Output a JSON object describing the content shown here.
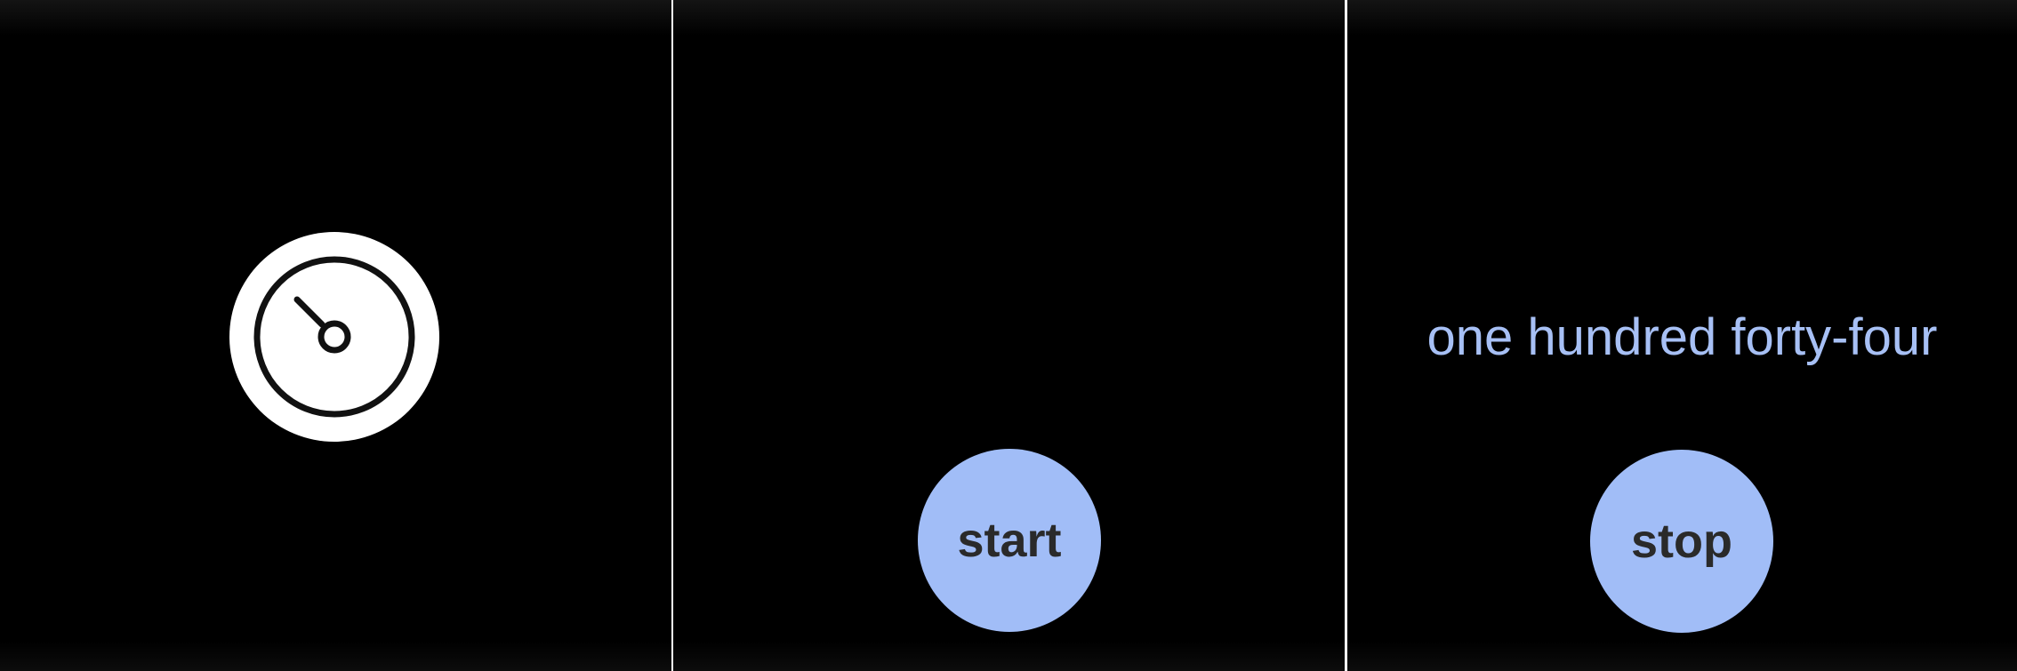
{
  "screens": [
    {
      "id": "home",
      "icon": "stopwatch-icon"
    },
    {
      "id": "ready",
      "button_label": "start"
    },
    {
      "id": "running",
      "spoken_text": "one hundred forty-four",
      "button_label": "stop"
    }
  ],
  "colors": {
    "background": "#000000",
    "button_fill": "#a1bdf7",
    "button_text": "#2a2a2a",
    "spoken_text": "#a7c0f5",
    "icon_fill": "#ffffff",
    "icon_stroke": "#111111"
  }
}
